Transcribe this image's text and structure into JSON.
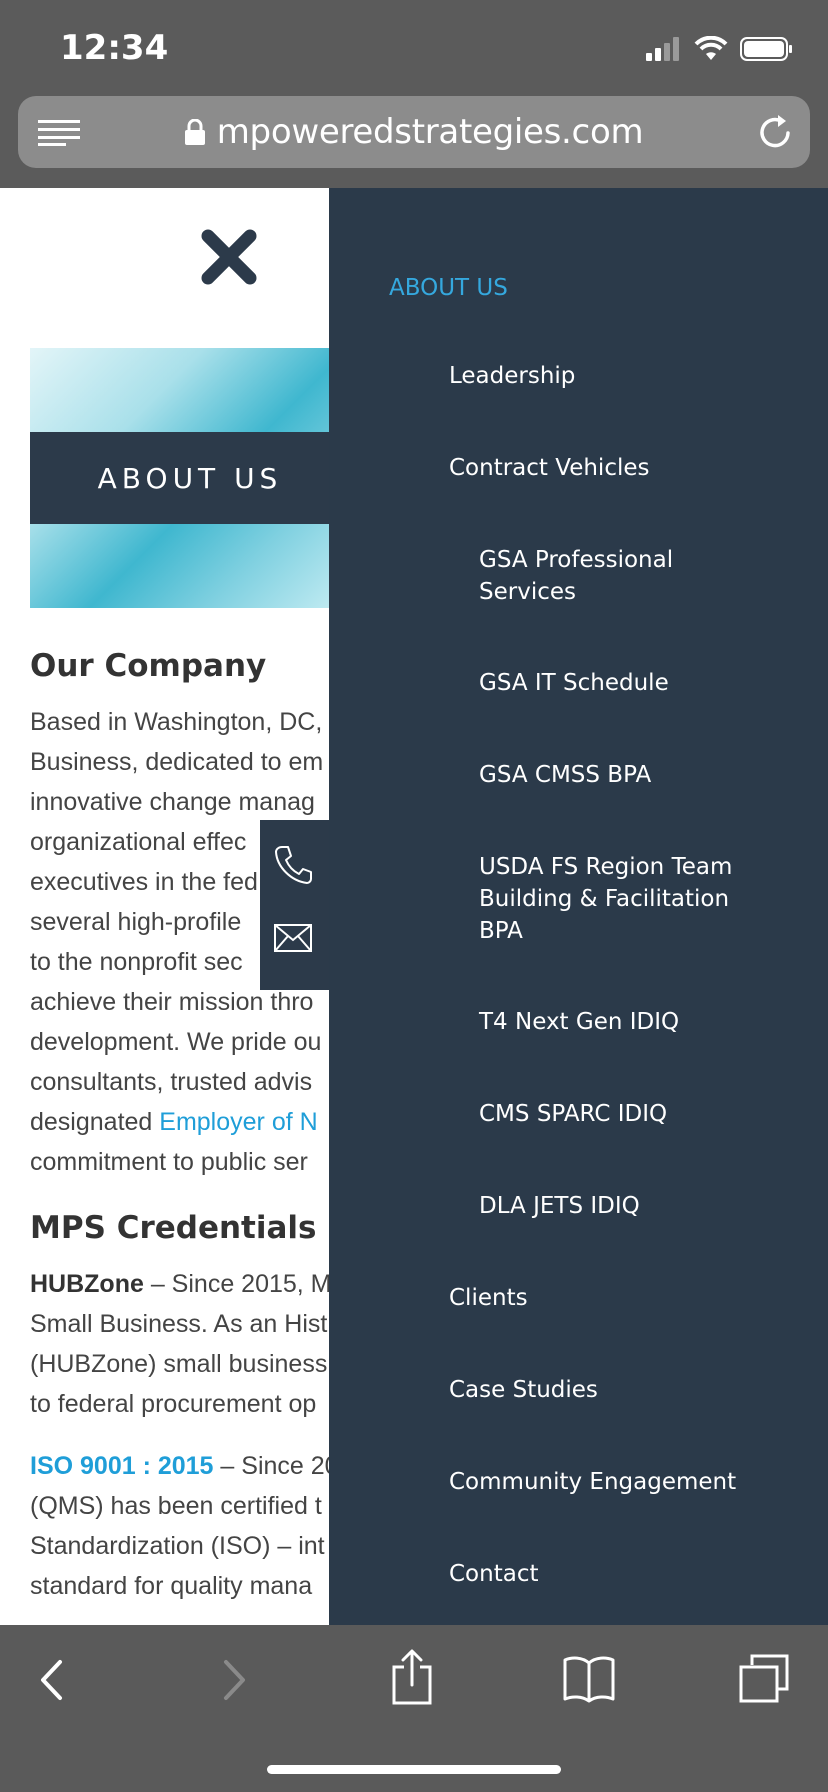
{
  "status": {
    "time": "12:34"
  },
  "browser": {
    "url": "mpoweredstrategies.com"
  },
  "banner": {
    "title": "ABOUT US"
  },
  "content": {
    "heading1": "Our Company",
    "para1": [
      "Based in Washington, DC,",
      "Business, dedicated to em",
      "innovative change manag",
      "organizational effec",
      "executives in the fed",
      "several high-profile",
      "to the nonprofit sec",
      "achieve their mission thro",
      "development. We pride ou",
      "consultants, trusted advis"
    ],
    "para1_line11_pre": "designated ",
    "para1_line11_link": "Employer of N",
    "para1_line12": "commitment to public ser",
    "heading2": "MPS Credentials",
    "hubzone_label": "HUBZone",
    "hubzone_line1_rest": " – Since 2015, M",
    "hubzone_lines": [
      "Small Business. As an Hist",
      "(HUBZone) small business",
      "to federal procurement op"
    ],
    "iso_label": "ISO 9001 : 2015",
    "iso_line1_rest": " – Since 20",
    "iso_lines": [
      "(QMS) has been certified t",
      "Standardization (ISO) – int",
      "standard for quality mana"
    ]
  },
  "menu": {
    "section": "ABOUT US",
    "items": [
      {
        "label": "Leadership"
      },
      {
        "label": "Contract Vehicles"
      },
      {
        "label": "GSA Professional Services",
        "lines": [
          "GSA Professional",
          "Services"
        ]
      },
      {
        "label": "GSA IT Schedule"
      },
      {
        "label": "GSA CMSS BPA"
      },
      {
        "label": "USDA FS Region Team Building & Facilitation BPA",
        "lines": [
          "USDA FS Region Team",
          "Building & Facilitation",
          "BPA"
        ]
      },
      {
        "label": "T4 Next Gen IDIQ"
      },
      {
        "label": "CMS SPARC IDIQ"
      },
      {
        "label": "DLA JETS IDIQ"
      },
      {
        "label": "Clients"
      },
      {
        "label": "Case Studies"
      },
      {
        "label": "Community Engagement"
      },
      {
        "label": "Contact"
      }
    ]
  },
  "icons": {
    "signal": "signal-icon",
    "wifi": "wifi-icon",
    "battery": "battery-icon",
    "reader": "reader-icon",
    "lock": "lock-icon",
    "reload": "reload-icon",
    "close": "close-icon",
    "phone": "phone-icon",
    "mail": "mail-icon",
    "back": "back-icon",
    "forward": "forward-icon",
    "share": "share-icon",
    "bookmarks": "bookmarks-icon",
    "tabs": "tabs-icon"
  },
  "colors": {
    "menu_bg": "#2b3a4a",
    "accent": "#35a8de",
    "link": "#1f9ed8",
    "chrome": "#5b5b5b"
  }
}
